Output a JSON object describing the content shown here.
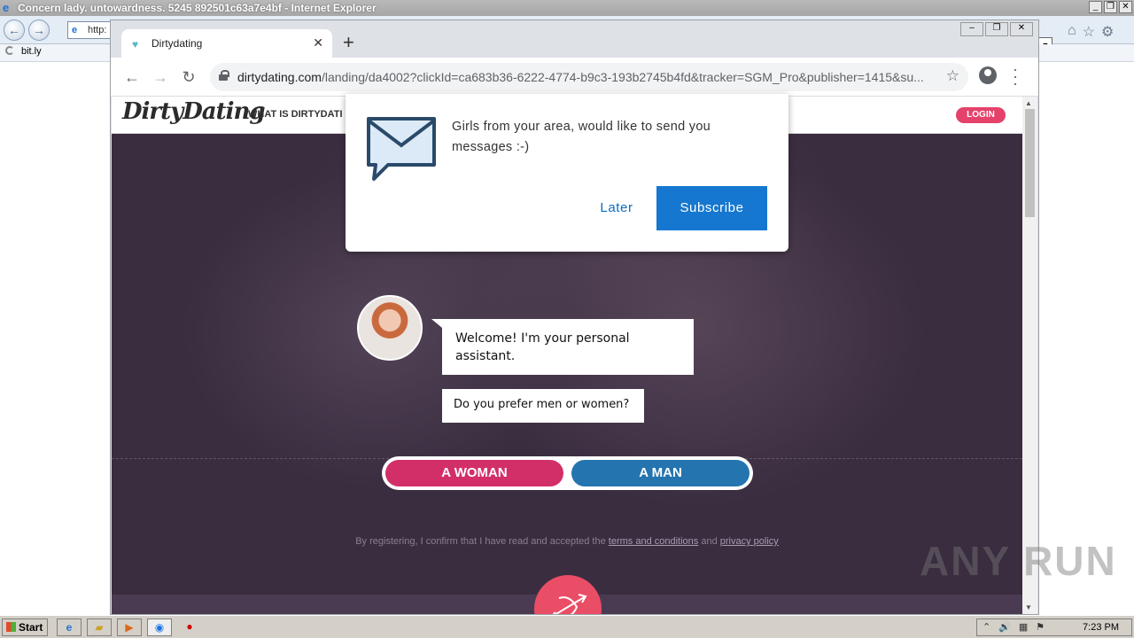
{
  "ie": {
    "title": "Concern lady. untowardness. 5245 892501c63a7e4bf - Internet Explorer",
    "address": "http:",
    "tab_label": "bit.ly"
  },
  "chrome": {
    "tab_title": "Dirtydating",
    "url_host": "dirtydating.com",
    "url_path": "/landing/da4002?clickId=ca683b36-6222-4774-b9c3-193b2745b4fd&tracker=SGM_Pro&publisher=1415&su..."
  },
  "site": {
    "logo": "DirtyDating",
    "nav_item": "WHAT IS DIRTYDATI",
    "login_label": "LOGIN"
  },
  "notification": {
    "message": "Girls from your area, would like to send you messages :-)",
    "later_label": "Later",
    "subscribe_label": "Subscribe"
  },
  "chat": {
    "welcome": "Welcome! I'm your personal assistant.",
    "question": "Do you prefer men or women?"
  },
  "choices": {
    "woman": "A WOMAN",
    "man": "A MAN"
  },
  "disclaimer": {
    "prefix": "By registering, I confirm that I have read and accepted the ",
    "terms": "terms and conditions",
    "and": " and ",
    "privacy": "privacy policy"
  },
  "watermark": "ANY RUN",
  "taskbar": {
    "start_label": "Start",
    "clock": "7:23 PM"
  },
  "colors": {
    "woman_button": "#d22f69",
    "man_button": "#2474b0",
    "subscribe_button": "#1577cf",
    "login_button": "#e5426b"
  }
}
